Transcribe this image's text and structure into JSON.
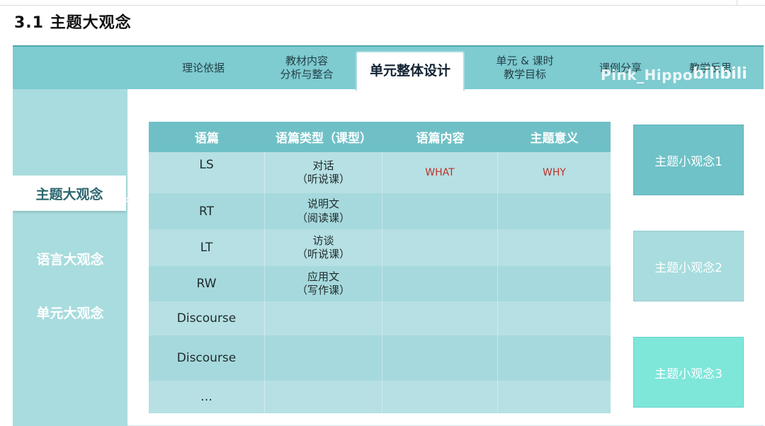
{
  "header": {
    "title": "3.1  主题大观念"
  },
  "nav": {
    "tabs": [
      {
        "label": "理论依据"
      },
      {
        "label": "教材内容\n分析与整合"
      },
      {
        "label": "单元整体设计"
      },
      {
        "label": "单元 & 课时\n教学目标"
      },
      {
        "label": "课例分享"
      },
      {
        "label": "教学反思"
      }
    ],
    "active_index": 2,
    "watermark": "Pink_Hippo",
    "bili_logo": "bilibili"
  },
  "sidebar": {
    "items": [
      {
        "label": "主题大观念"
      },
      {
        "label": "语言大观念"
      },
      {
        "label": "单元大观念"
      }
    ],
    "active_index": 0,
    "arrow": "›"
  },
  "table": {
    "headers": [
      "语篇",
      "语篇类型（课型）",
      "语篇内容",
      "主题意义"
    ],
    "rows": [
      {
        "text": "LS",
        "type": "对话\n（听说课）",
        "content": "WHAT",
        "meaning": "WHY"
      },
      {
        "text": "RT",
        "type": "说明文\n（阅读课）",
        "content": "",
        "meaning": ""
      },
      {
        "text": "LT",
        "type": "访谈\n（听说课）",
        "content": "",
        "meaning": ""
      },
      {
        "text": "RW",
        "type": "应用文\n（写作课）",
        "content": "",
        "meaning": ""
      },
      {
        "text": "Discourse",
        "type": "",
        "content": "",
        "meaning": ""
      },
      {
        "text": "Discourse",
        "type": "",
        "content": "",
        "meaning": ""
      },
      {
        "text": "…",
        "type": "",
        "content": "",
        "meaning": ""
      }
    ]
  },
  "cards": [
    {
      "label": "主题小观念1"
    },
    {
      "label": "主题小观念2"
    },
    {
      "label": "主题小观念3"
    }
  ],
  "colors": {
    "nav_bg": "#7ecbd0",
    "sidebar_bg": "#a8dcde",
    "table_header": "#6fc0c6",
    "card1": "#6fc2c8",
    "card2": "#a8dcde",
    "card3": "#7fe6da",
    "accent_red": "#c0302a"
  }
}
